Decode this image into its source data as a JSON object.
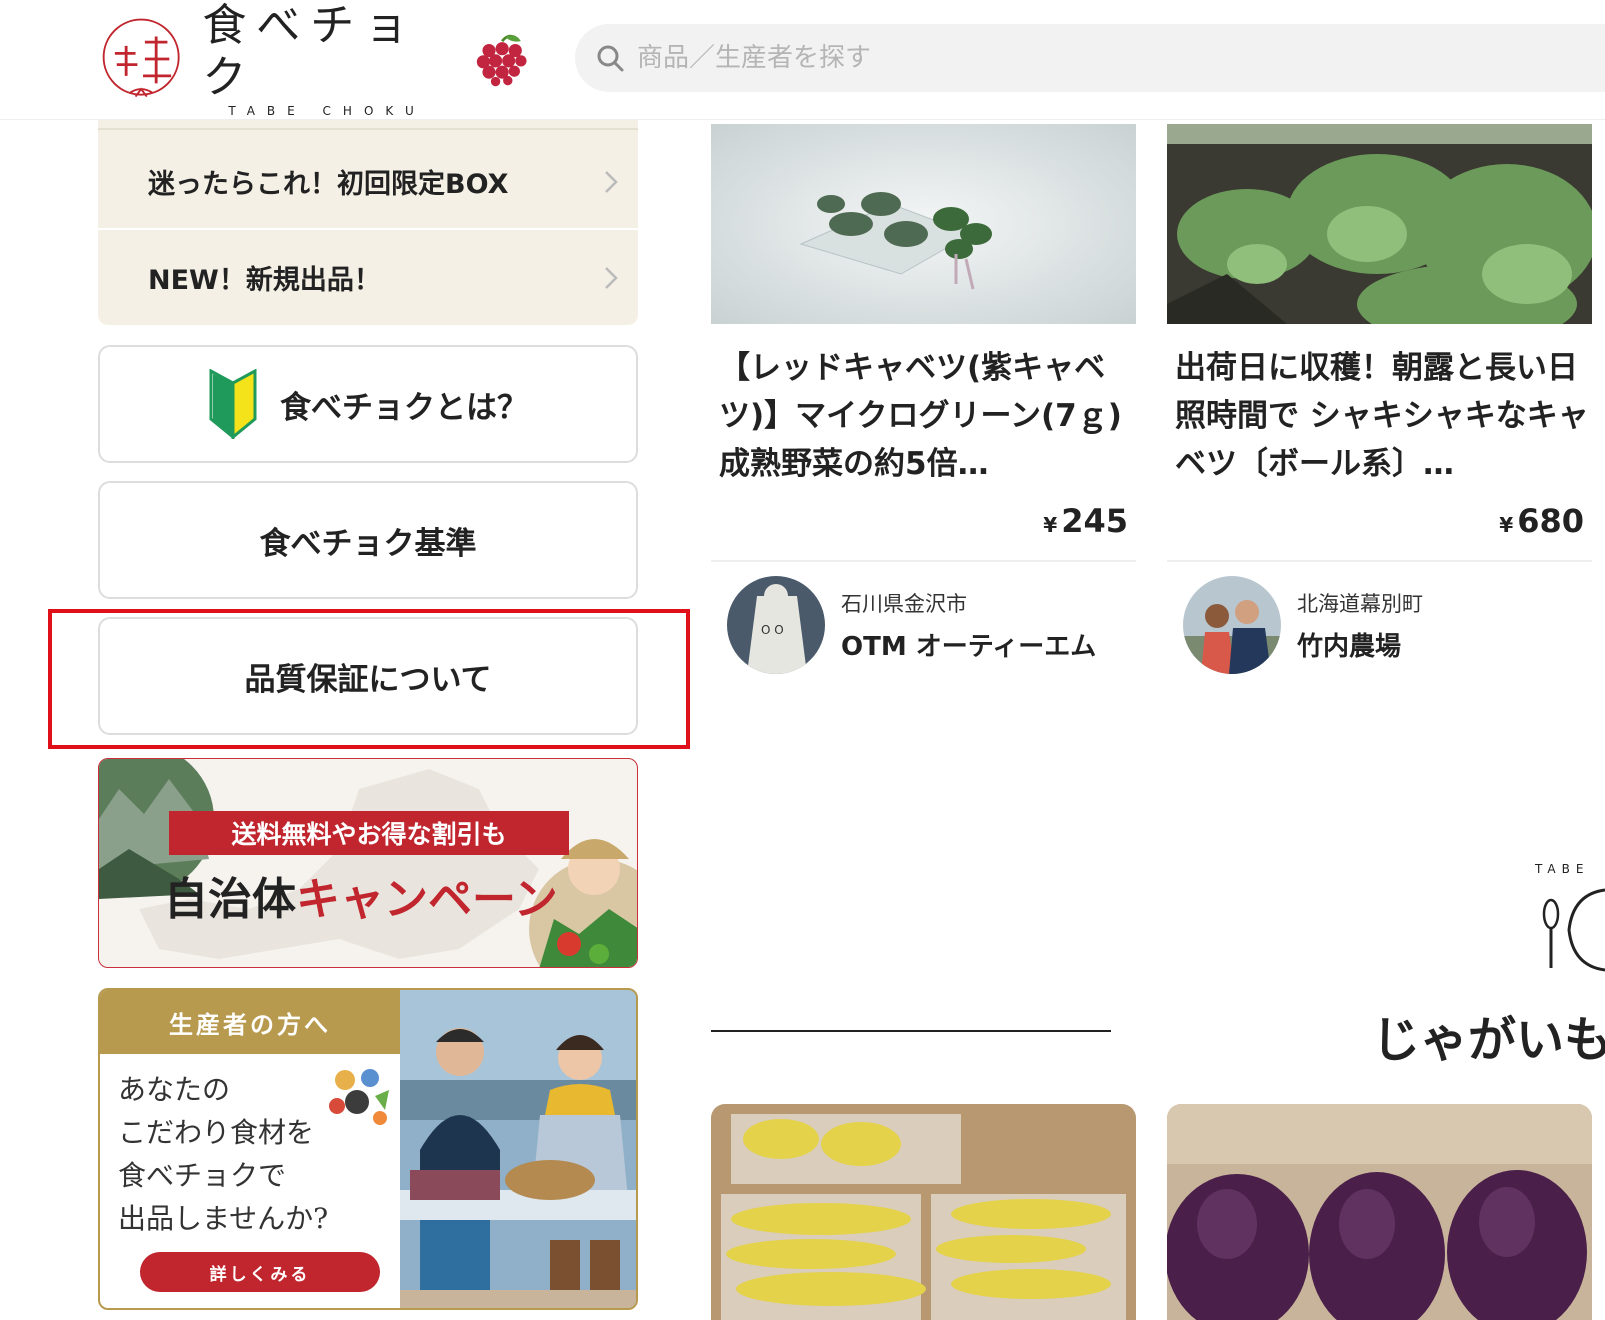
{
  "header": {
    "logo_jp": "食べチョク",
    "logo_en": "TABE CHOKU",
    "search_placeholder": "商品／生産者を探す"
  },
  "sidebar": {
    "links": [
      {
        "label": "迷ったらこれ！初回限定BOX"
      },
      {
        "label": "NEW！新規出品！"
      }
    ],
    "buttons": [
      {
        "label": "食べチョクとは？"
      },
      {
        "label": "食べチョク基準"
      },
      {
        "label": "品質保証について"
      }
    ],
    "campaign": {
      "ribbon": "送料無料やお得な割引も",
      "title_dark": "自治体",
      "title_red": "キャンペーン"
    },
    "producer_banner": {
      "head": "生産者の方へ",
      "line1": "あなたの",
      "line2": "こだわり食材を",
      "line3": "食べチョクで",
      "line4": "出品しませんか?",
      "button": "詳しくみる"
    }
  },
  "products": [
    {
      "title": "【レッドキャベツ(紫キャベツ)】マイクログリーン(7ｇ)成熟野菜の約5倍…",
      "price_symbol": "¥",
      "price": "245",
      "seller_location": "石川県金沢市",
      "seller_name": "OTM オーティーエム"
    },
    {
      "title": "出荷日に収穫！朝露と長い日照時間で シャキシャキなキャベツ〔ボール系〕…",
      "price_symbol": "¥",
      "price": "680",
      "seller_location": "北海道幕別町",
      "seller_name": "竹内農場"
    }
  ],
  "section": {
    "brand_small": "TABE",
    "title": "じゃがいも"
  },
  "colors": {
    "accent_red": "#c1252d",
    "highlight_red": "#e0101a",
    "gold": "#b89a4f",
    "beige": "#f4f0e6"
  }
}
